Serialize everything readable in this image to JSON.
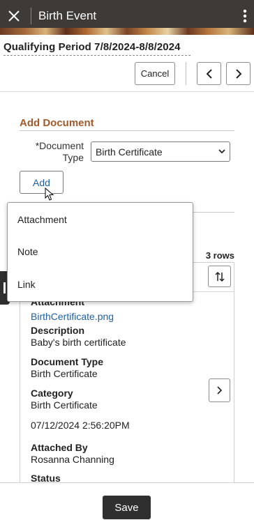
{
  "header": {
    "title": "Birth Event",
    "close_icon": "close-icon",
    "menu_icon": "kebab-menu-icon"
  },
  "qualifying": {
    "title": "Qualifying Period 7/8/2024-8/8/2024",
    "cancel_label": "Cancel",
    "prev_icon": "chevron-left-icon",
    "next_icon": "chevron-right-icon"
  },
  "add_document": {
    "section_title": "Add Document",
    "document_type_label": "*Document Type",
    "document_type_value": "Birth Certificate",
    "add_label": "Add"
  },
  "menu": {
    "items": [
      {
        "label": "Attachment"
      },
      {
        "label": "Note"
      },
      {
        "label": "Link"
      }
    ]
  },
  "grid": {
    "rows_count": "3 rows",
    "sort_icon": "sort-icon",
    "row": {
      "attachment_label": "Attachment",
      "attachment_file": "BirthCertificate.png",
      "description_label": "Description",
      "description_value": "Baby's birth certificate",
      "doc_type_label": "Document Type",
      "doc_type_value": "Birth Certificate",
      "category_label": "Category",
      "category_value": "Birth Certificate",
      "datetime": "07/12/2024  2:56:20PM",
      "attached_by_label": "Attached By",
      "attached_by_value": "Rosanna Channing",
      "status_label": "Status"
    }
  },
  "footer": {
    "save_label": "Save"
  },
  "colors": {
    "header_bg": "#3d3a37",
    "section_title": "#a05a2c",
    "link": "#1f5fa6",
    "primary_button": "#2f2f2f"
  }
}
